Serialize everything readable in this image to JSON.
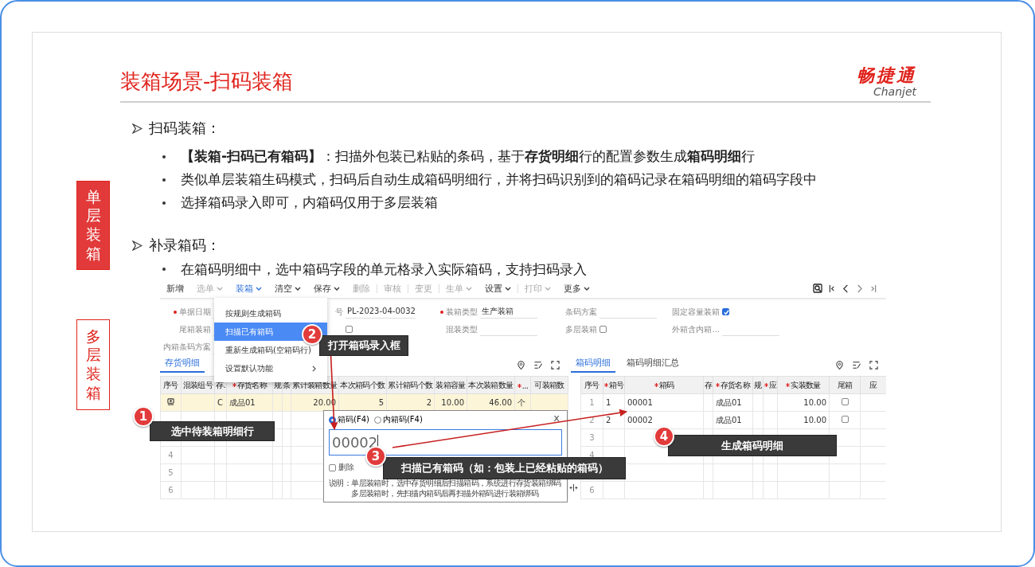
{
  "title": "装箱场景-扫码装箱",
  "logo": {
    "mark": "畅捷通",
    "wordmark": "Chanjet"
  },
  "side_tags": [
    {
      "text": "单层装箱",
      "selected": true
    },
    {
      "text": "多层装箱",
      "selected": false
    }
  ],
  "sections": [
    {
      "heading": "扫码装箱：",
      "bullets": [
        "**【装箱-扫码已有箱码】**：扫描外包装已粘贴的条码，基于**存货明细**行的配置参数生成**箱码明细**行",
        "类似单层装箱生码模式，扫码后自动生成箱码明细行，并将扫码识别到的箱码记录在箱码明细的箱码字段中",
        "选择箱码录入即可，内箱码仅用于多层装箱"
      ]
    },
    {
      "heading": "补录箱码：",
      "bullets": [
        "在箱码明细中，选中箱码字段的单元格录入实际箱码，支持扫码录入"
      ]
    }
  ],
  "app": {
    "toolbar": [
      {
        "label": "新增",
        "disabled": false,
        "selected": false,
        "dropdown": false,
        "separator_before": false
      },
      {
        "label": "选单",
        "disabled": true,
        "selected": false,
        "dropdown": true,
        "separator_before": false
      },
      {
        "label": "装箱",
        "disabled": false,
        "selected": true,
        "dropdown": true,
        "separator_before": false
      },
      {
        "label": "清空",
        "disabled": false,
        "selected": false,
        "dropdown": true,
        "separator_before": false
      },
      {
        "label": "保存",
        "disabled": false,
        "selected": false,
        "dropdown": true,
        "separator_before": false
      },
      {
        "label": "删除",
        "disabled": true,
        "selected": false,
        "dropdown": false,
        "separator_before": false
      },
      {
        "label": "审核",
        "disabled": true,
        "selected": false,
        "dropdown": false,
        "separator_before": true
      },
      {
        "label": "变更",
        "disabled": true,
        "selected": false,
        "dropdown": false,
        "separator_before": true
      },
      {
        "label": "生单",
        "disabled": true,
        "selected": false,
        "dropdown": true,
        "separator_before": true
      },
      {
        "label": "设置",
        "disabled": false,
        "selected": false,
        "dropdown": true,
        "separator_before": false
      },
      {
        "label": "打印",
        "disabled": true,
        "selected": false,
        "dropdown": true,
        "separator_before": true
      },
      {
        "label": "更多",
        "disabled": false,
        "selected": false,
        "dropdown": true,
        "separator_before": false
      }
    ],
    "form": [
      [
        {
          "kind": "text",
          "label": "单据日期",
          "required": true
        },
        {
          "kind": "text",
          "label": "号",
          "value": "PL-2023-04-0032"
        },
        {
          "kind": "text",
          "label": "装箱类型",
          "required": true,
          "value": "生产装箱"
        },
        {
          "kind": "text",
          "label": "条码方案",
          "required": false
        },
        {
          "kind": "checkbox",
          "label": "固定容量装箱",
          "checked": true
        }
      ],
      [
        {
          "kind": "text",
          "label": "尾箱装箱",
          "required": false
        },
        {
          "kind": "checkbox",
          "checked": false
        },
        {
          "kind": "text",
          "label": "混装类型",
          "required": false
        },
        {
          "kind": "checkbox",
          "label": "多层装箱",
          "checked": false
        },
        {
          "kind": "text",
          "label": "外箱含内箱...",
          "required": false
        }
      ],
      [
        {
          "kind": "text",
          "label": "内箱条码方案"
        }
      ]
    ],
    "menu": [
      {
        "label": "按规则生成箱码",
        "selected": false,
        "submenu": false
      },
      {
        "label": "扫描已有箱码",
        "selected": true,
        "submenu": false
      },
      {
        "label": "重新生成箱码(空箱码行)",
        "selected": false,
        "submenu": false
      },
      {
        "label": "设置默认功能",
        "selected": false,
        "submenu": true
      }
    ],
    "left_panel": {
      "tabs": [
        {
          "label": "存货明细",
          "selected": true
        }
      ],
      "columns": [
        {
          "label": "序号",
          "required": false
        },
        {
          "label": "混装组号",
          "required": false
        },
        {
          "label": "存.",
          "required": false
        },
        {
          "label": "存货名称",
          "required": true
        },
        {
          "label": "规",
          "required": false
        },
        {
          "label": "条",
          "required": false
        },
        {
          "label": "累计装箱数量",
          "required": false
        },
        {
          "label": "本次箱码个数",
          "required": false
        },
        {
          "label": "累计箱码个数",
          "required": false
        },
        {
          "label": "装箱容量",
          "required": false
        },
        {
          "label": "本次装箱数量",
          "required": false
        },
        {
          "label": "...",
          "required": true
        },
        {
          "label": "可装箱数",
          "required": false
        }
      ],
      "rows": [
        {
          "selected": true,
          "cells": [
            null,
            null,
            "C",
            "成品01",
            null,
            null,
            "20.00",
            "5",
            "2",
            "10.00",
            "46.00",
            "个"
          ]
        },
        {
          "selected": false
        },
        {
          "selected": false
        },
        {
          "selected": false,
          "cells": [
            "4"
          ]
        },
        {
          "selected": false,
          "cells": [
            "5"
          ]
        },
        {
          "selected": false,
          "cells": [
            "6"
          ]
        }
      ]
    },
    "right_panel": {
      "tabs": [
        {
          "label": "箱码明细",
          "selected": true
        },
        {
          "label": "箱码明细汇总",
          "selected": false
        }
      ],
      "columns": [
        {
          "label": "序号",
          "required": false
        },
        {
          "label": "箱号",
          "required": true
        },
        {
          "label": "箱码",
          "required": true
        },
        {
          "label": "存",
          "required": false
        },
        {
          "label": "存货名称",
          "required": true
        },
        {
          "label": "规",
          "required": false
        },
        {
          "label": "应",
          "required": true
        },
        {
          "label": "实装数量",
          "required": true
        },
        {
          "label": "尾箱",
          "required": false
        },
        {
          "label": "应",
          "required": false
        }
      ],
      "rows": [
        {
          "cells": [
            "1",
            "1",
            "00001",
            null,
            "成品01",
            null,
            null,
            "10.00",
            false
          ]
        },
        {
          "cells": [
            "2",
            "2",
            "00002",
            null,
            "成品01",
            null,
            null,
            "10.00",
            false
          ]
        },
        {
          "cells": [
            "3"
          ]
        },
        {
          "cells": [
            "4"
          ]
        },
        {},
        {
          "cells": [
            "6"
          ]
        }
      ]
    },
    "dialog": {
      "radios": [
        {
          "label": "箱码(F4)",
          "selected": true
        },
        {
          "label": "内箱码(F4)",
          "selected": false
        }
      ],
      "close": "x",
      "value": "00002",
      "delete": {
        "label": "删除",
        "checked": false
      },
      "note_label": "说明：",
      "note_lines": [
        "单层装箱时，选中存货明细后扫描箱码，系统进行存货装箱绑码",
        "多层装箱时，先扫描内箱码后再扫描外箱码进行装箱绑码"
      ]
    }
  },
  "callouts": [
    {
      "number": "1",
      "text": "选中待装箱明细行"
    },
    {
      "number": "2",
      "text": "打开箱码录入框"
    },
    {
      "number": "3",
      "text": "扫描已有箱码（如：包装上已经粘贴的箱码）"
    },
    {
      "number": "4",
      "text": "生成箱码明细"
    }
  ]
}
